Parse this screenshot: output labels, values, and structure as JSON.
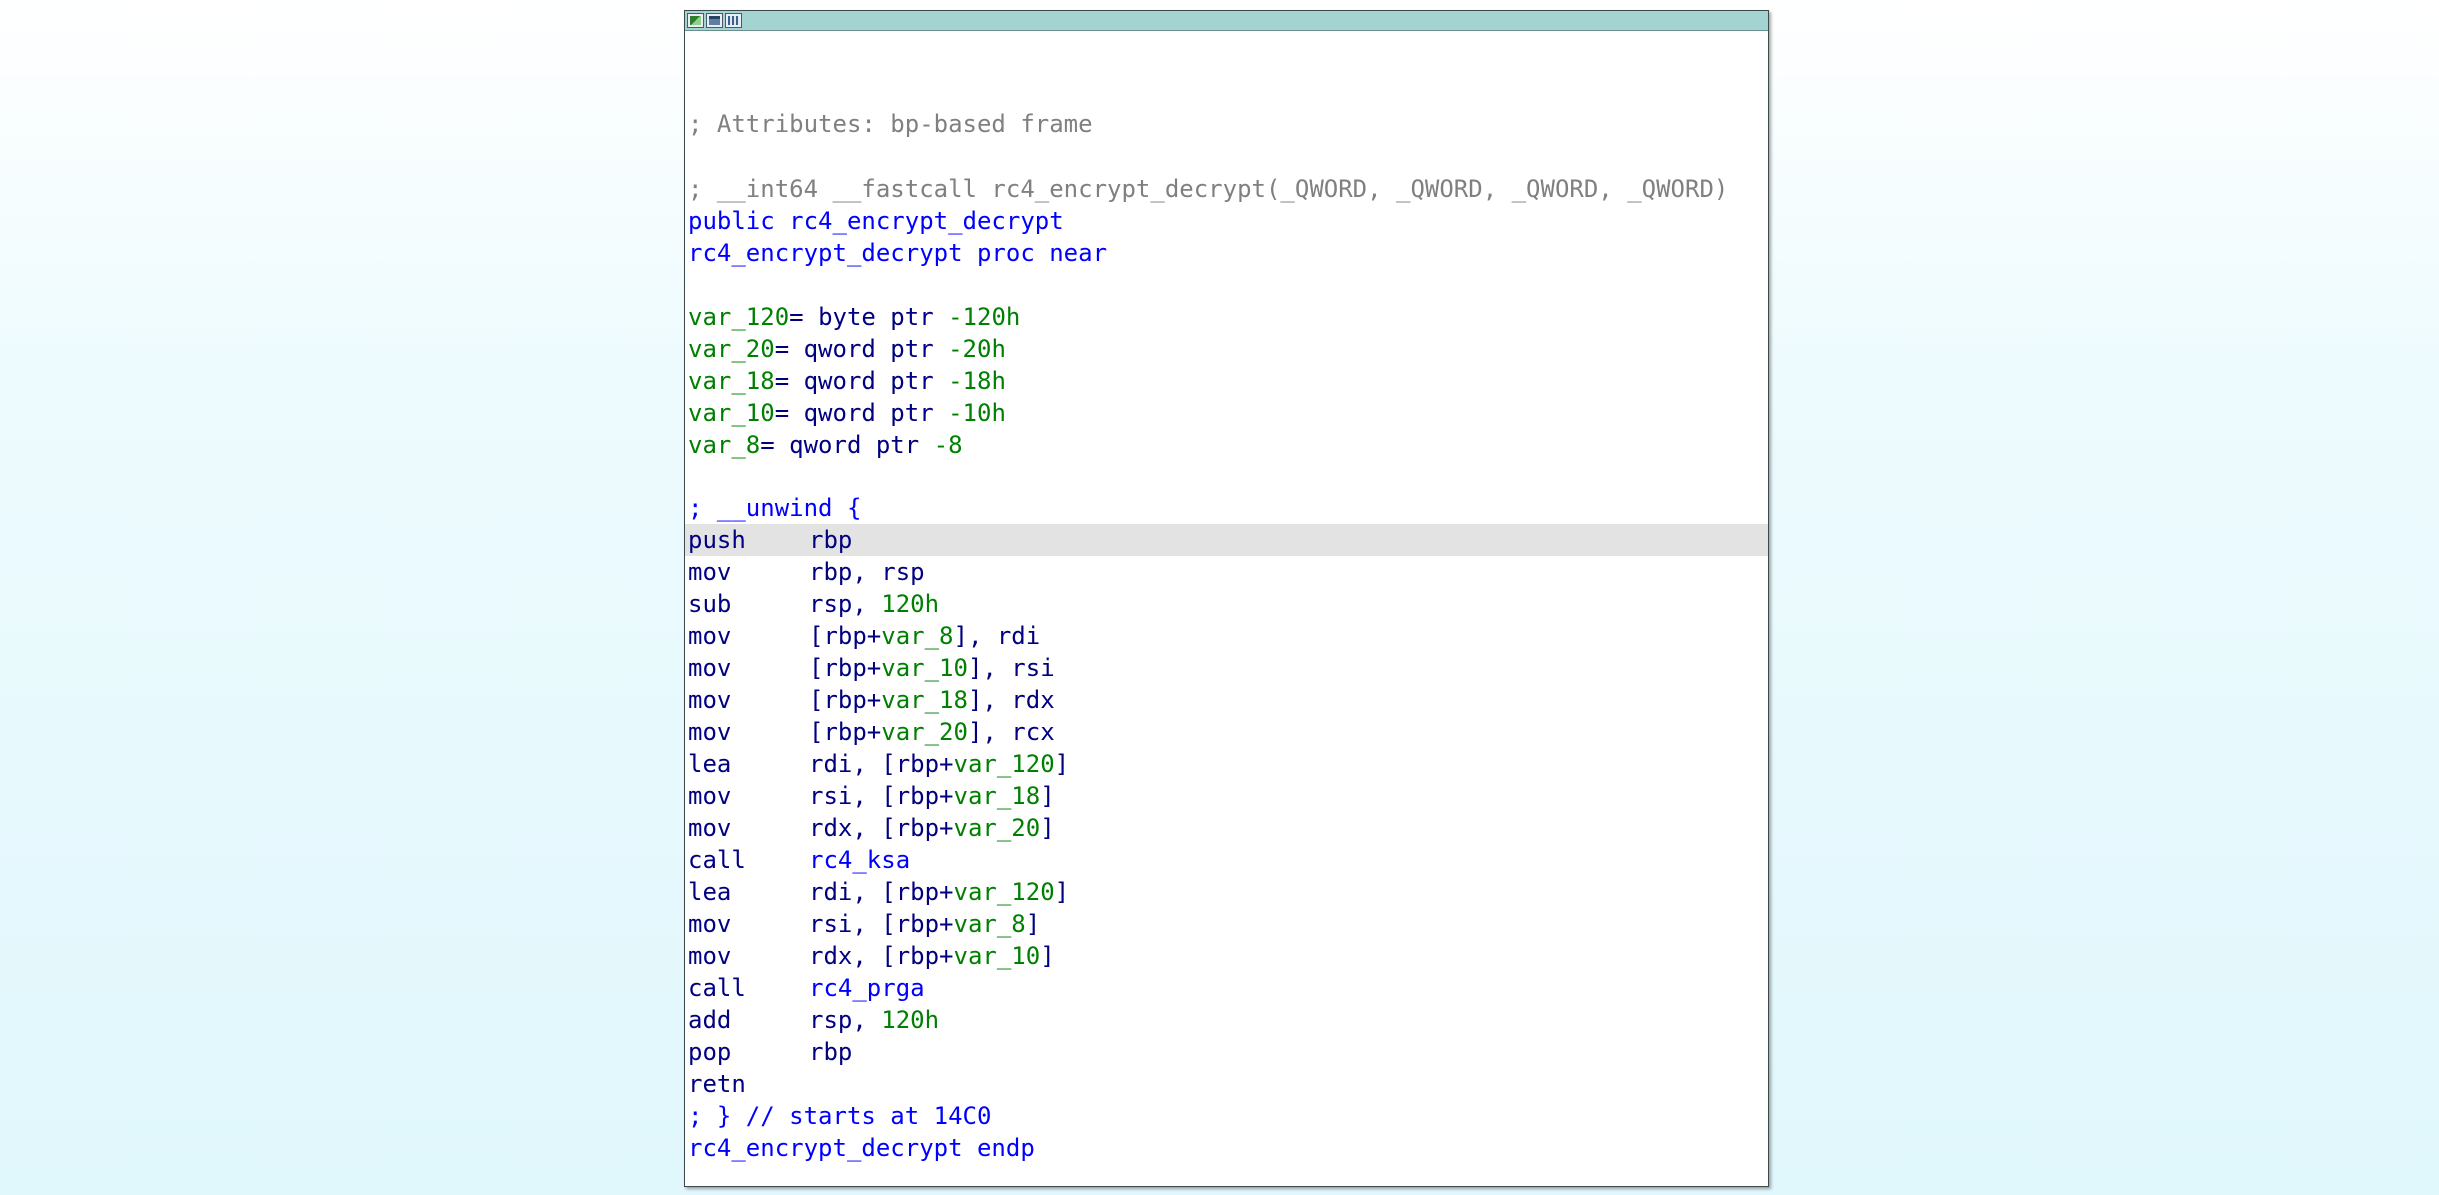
{
  "window": {
    "titlebar_buttons": [
      {
        "name": "set-node-color",
        "icon": "color-icon"
      },
      {
        "name": "rename",
        "icon": "rename-icon"
      },
      {
        "name": "group-nodes",
        "icon": "group-icon"
      }
    ]
  },
  "header": {
    "attributes": "; Attributes: bp-based frame",
    "signature": "; __int64 __fastcall rc4_encrypt_decrypt(_QWORD, _QWORD, _QWORD, _QWORD)",
    "public_decl": "public rc4_encrypt_decrypt",
    "proc_start": "rc4_encrypt_decrypt proc near"
  },
  "vars": [
    {
      "name": "var_120",
      "eq": "= ",
      "type": "byte ptr ",
      "value": "-120h"
    },
    {
      "name": "var_20",
      "eq": "= ",
      "type": "qword ptr ",
      "value": "-20h"
    },
    {
      "name": "var_18",
      "eq": "= ",
      "type": "qword ptr ",
      "value": "-18h"
    },
    {
      "name": "var_10",
      "eq": "= ",
      "type": "qword ptr ",
      "value": "-10h"
    },
    {
      "name": "var_8",
      "eq": "= ",
      "type": "qword ptr ",
      "value": "-8"
    }
  ],
  "unwind_start": "; __unwind {",
  "instructions": [
    {
      "mnem": "push",
      "ops": [
        {
          "t": "rbp",
          "c": "navy"
        }
      ],
      "highlight": true
    },
    {
      "mnem": "mov",
      "ops": [
        {
          "t": "rbp, rsp",
          "c": "navy"
        }
      ]
    },
    {
      "mnem": "sub",
      "ops": [
        {
          "t": "rsp, ",
          "c": "navy"
        },
        {
          "t": "120h",
          "c": "green"
        }
      ]
    },
    {
      "mnem": "mov",
      "ops": [
        {
          "t": "[rbp+",
          "c": "navy"
        },
        {
          "t": "var_8",
          "c": "green"
        },
        {
          "t": "], rdi",
          "c": "navy"
        }
      ]
    },
    {
      "mnem": "mov",
      "ops": [
        {
          "t": "[rbp+",
          "c": "navy"
        },
        {
          "t": "var_10",
          "c": "green"
        },
        {
          "t": "], rsi",
          "c": "navy"
        }
      ]
    },
    {
      "mnem": "mov",
      "ops": [
        {
          "t": "[rbp+",
          "c": "navy"
        },
        {
          "t": "var_18",
          "c": "green"
        },
        {
          "t": "], rdx",
          "c": "navy"
        }
      ]
    },
    {
      "mnem": "mov",
      "ops": [
        {
          "t": "[rbp+",
          "c": "navy"
        },
        {
          "t": "var_20",
          "c": "green"
        },
        {
          "t": "], rcx",
          "c": "navy"
        }
      ]
    },
    {
      "mnem": "lea",
      "ops": [
        {
          "t": "rdi, [rbp+",
          "c": "navy"
        },
        {
          "t": "var_120",
          "c": "green"
        },
        {
          "t": "]",
          "c": "navy"
        }
      ]
    },
    {
      "mnem": "mov",
      "ops": [
        {
          "t": "rsi, [rbp+",
          "c": "navy"
        },
        {
          "t": "var_18",
          "c": "green"
        },
        {
          "t": "]",
          "c": "navy"
        }
      ]
    },
    {
      "mnem": "mov",
      "ops": [
        {
          "t": "rdx, [rbp+",
          "c": "navy"
        },
        {
          "t": "var_20",
          "c": "green"
        },
        {
          "t": "]",
          "c": "navy"
        }
      ]
    },
    {
      "mnem": "call",
      "ops": [
        {
          "t": "rc4_ksa",
          "c": "blue"
        }
      ]
    },
    {
      "mnem": "lea",
      "ops": [
        {
          "t": "rdi, [rbp+",
          "c": "navy"
        },
        {
          "t": "var_120",
          "c": "green"
        },
        {
          "t": "]",
          "c": "navy"
        }
      ]
    },
    {
      "mnem": "mov",
      "ops": [
        {
          "t": "rsi, [rbp+",
          "c": "navy"
        },
        {
          "t": "var_8",
          "c": "green"
        },
        {
          "t": "]",
          "c": "navy"
        }
      ]
    },
    {
      "mnem": "mov",
      "ops": [
        {
          "t": "rdx, [rbp+",
          "c": "navy"
        },
        {
          "t": "var_10",
          "c": "green"
        },
        {
          "t": "]",
          "c": "navy"
        }
      ]
    },
    {
      "mnem": "call",
      "ops": [
        {
          "t": "rc4_prga",
          "c": "blue"
        }
      ]
    },
    {
      "mnem": "add",
      "ops": [
        {
          "t": "rsp, ",
          "c": "navy"
        },
        {
          "t": "120h",
          "c": "green"
        }
      ]
    },
    {
      "mnem": "pop",
      "ops": [
        {
          "t": "rbp",
          "c": "navy"
        }
      ]
    },
    {
      "mnem": "retn",
      "ops": []
    }
  ],
  "unwind_end": "; } // starts at 14C0",
  "proc_end": "rc4_encrypt_decrypt endp",
  "colors": {
    "titlebar": "#a3d4d2",
    "comment": "#808080",
    "name": "#0000ff",
    "instruction": "#000080",
    "number": "#008000",
    "highlight": "#e3e3e3"
  }
}
